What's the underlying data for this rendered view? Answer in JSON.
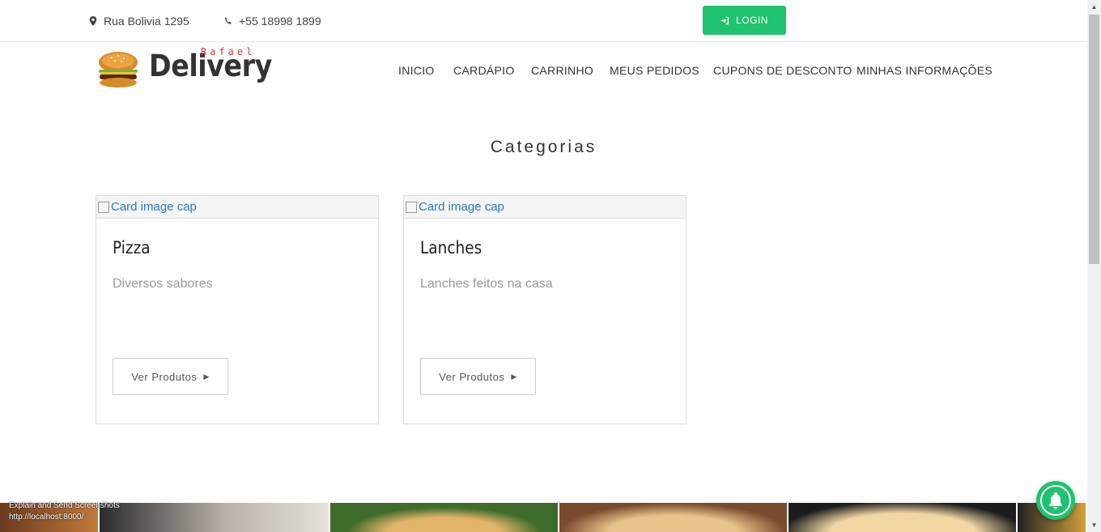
{
  "topbar": {
    "address": "Rua Bolivia 1295",
    "address_icon": "map-marker-icon",
    "phone": "+55 18998 1899",
    "phone_icon": "phone-icon",
    "login_label": "LOGIN",
    "login_icon": "sign-in-icon",
    "login_color": "#1fc26e"
  },
  "logo": {
    "small": "Rafael",
    "big": "Delivery",
    "small_color": "#e53935"
  },
  "nav": {
    "items": [
      "INICIO",
      "CARDÁPIO",
      "CARRINHO",
      "MEUS PEDIDOS",
      "CUPONS DE DESCONTO",
      "MINHAS INFORMAÇÕES"
    ]
  },
  "section": {
    "title": "Categorias"
  },
  "cards": [
    {
      "img_alt": "Card image cap",
      "title": "Pizza",
      "description": "Diversos sabores",
      "button": "Ver Produtos"
    },
    {
      "img_alt": "Card image cap",
      "title": "Lanches",
      "description": "Lanches feitos na casa",
      "button": "Ver Produtos"
    }
  ],
  "overlay": {
    "line1": "Explain and Send Screenshots",
    "line2": "http://localhost:8000/"
  },
  "notification": {
    "icon": "bell-icon"
  }
}
